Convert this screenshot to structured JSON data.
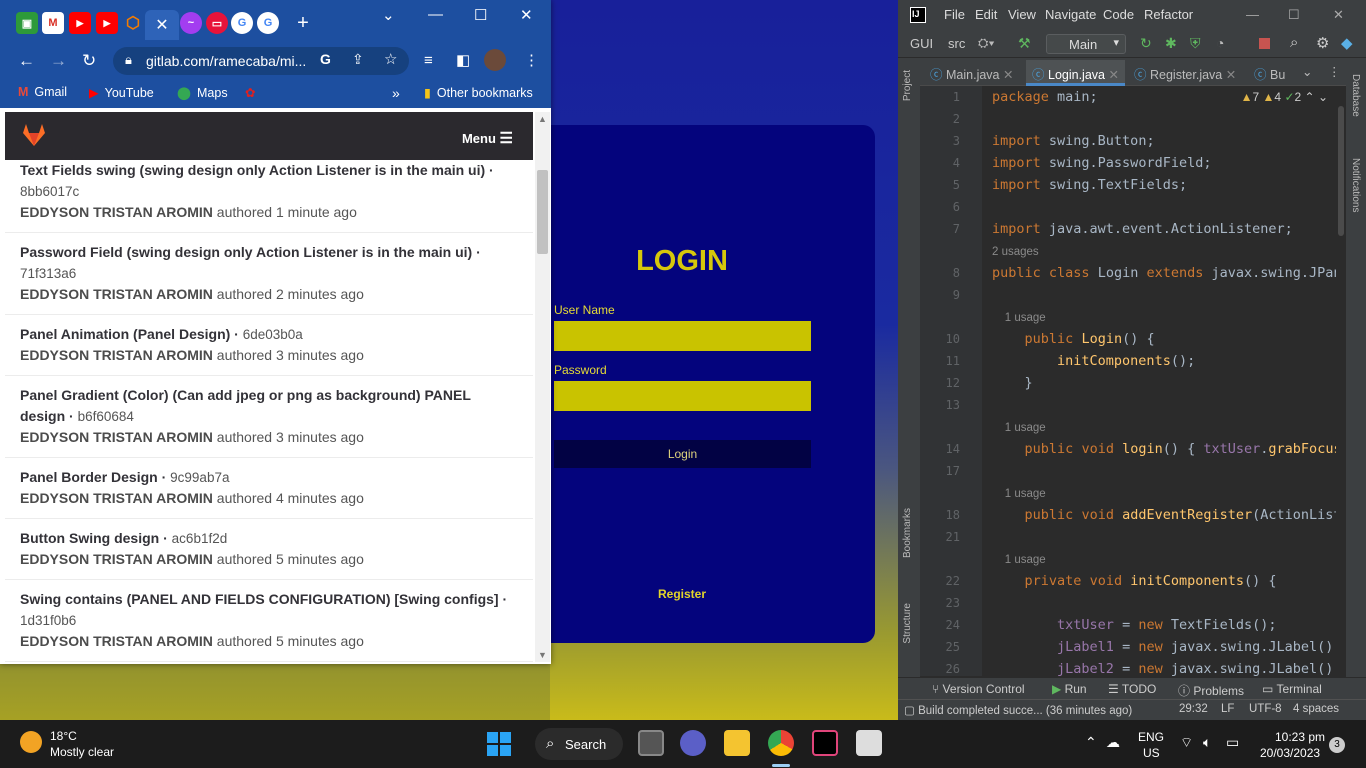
{
  "app_window": {
    "title": "LOGIN",
    "username_label": "User Name",
    "password_label": "Password",
    "login_button": "Login",
    "register_link": "Register"
  },
  "browser": {
    "url": "gitlab.com/ramecaba/mi...",
    "bookmarks": [
      "Gmail",
      "YouTube",
      "Maps"
    ],
    "other_bookmarks": "Other bookmarks",
    "gitlab_menu": "Menu",
    "commits": [
      {
        "title": "Text Fields swing (swing design only Action Listener is in the main ui)",
        "sha": "8bb6017c",
        "author": "EDDYSON TRISTAN AROMIN",
        "time": "authored 1 minute ago"
      },
      {
        "title": "Password Field (swing design only Action Listener is in the main ui)",
        "sha": "71f313a6",
        "author": "EDDYSON TRISTAN AROMIN",
        "time": "authored 2 minutes ago"
      },
      {
        "title": "Panel Animation (Panel Design)",
        "sha": "6de03b0a",
        "author": "EDDYSON TRISTAN AROMIN",
        "time": "authored 3 minutes ago"
      },
      {
        "title": "Panel Gradient (Color) (Can add jpeg or png as background) PANEL design",
        "sha": "b6f60684",
        "author": "EDDYSON TRISTAN AROMIN",
        "time": "authored 3 minutes ago"
      },
      {
        "title": "Panel Border Design",
        "sha": "9c99ab7a",
        "author": "EDDYSON TRISTAN AROMIN",
        "time": "authored 4 minutes ago"
      },
      {
        "title": "Button Swing design",
        "sha": "ac6b1f2d",
        "author": "EDDYSON TRISTAN AROMIN",
        "time": "authored 5 minutes ago"
      },
      {
        "title": "Swing contains (PANEL AND FIELDS CONFIGURATION) [Swing configs]",
        "sha": "1d31f0b6",
        "author": "EDDYSON TRISTAN AROMIN",
        "time": "authored 5 minutes ago"
      }
    ]
  },
  "ide": {
    "menu": [
      "File",
      "Edit",
      "View",
      "Navigate",
      "Code",
      "Refactor"
    ],
    "project": "GUI",
    "folder": "src",
    "run_config": "Main",
    "tabs": [
      "Main.java",
      "Login.java",
      "Register.java",
      "Bu"
    ],
    "inspections": {
      "warnings": "7",
      "weak": "4",
      "typos": "2"
    },
    "side_left": [
      "Project",
      "Bookmarks",
      "Structure"
    ],
    "side_right": [
      "Database",
      "Notifications"
    ],
    "lines": [
      {
        "n": "1",
        "code": "package main;"
      },
      {
        "n": "2",
        "code": ""
      },
      {
        "n": "3",
        "code": "import swing.Button;"
      },
      {
        "n": "4",
        "code": "import swing.PasswordField;"
      },
      {
        "n": "5",
        "code": "import swing.TextFields;"
      },
      {
        "n": "6",
        "code": ""
      },
      {
        "n": "7",
        "code": "import java.awt.event.ActionListener;"
      },
      {
        "n": "",
        "code": "2 usages"
      },
      {
        "n": "8",
        "code": "public class Login extends javax.swing.JPane"
      },
      {
        "n": "9",
        "code": ""
      },
      {
        "n": "",
        "code": "    1 usage"
      },
      {
        "n": "10",
        "code": "    public Login() {"
      },
      {
        "n": "11",
        "code": "        initComponents();"
      },
      {
        "n": "12",
        "code": "    }"
      },
      {
        "n": "13",
        "code": ""
      },
      {
        "n": "",
        "code": "    1 usage"
      },
      {
        "n": "14",
        "code": "    public void login() { txtUser.grabFocus("
      },
      {
        "n": "17",
        "code": ""
      },
      {
        "n": "",
        "code": "    1 usage"
      },
      {
        "n": "18",
        "code": "    public void addEventRegister(ActionListe"
      },
      {
        "n": "21",
        "code": ""
      },
      {
        "n": "",
        "code": "    1 usage"
      },
      {
        "n": "22",
        "code": "    private void initComponents() {"
      },
      {
        "n": "23",
        "code": ""
      },
      {
        "n": "24",
        "code": "        txtUser = new TextFields();"
      },
      {
        "n": "25",
        "code": "        jLabel1 = new javax.swing.JLabel();"
      },
      {
        "n": "26",
        "code": "        jLabel2 = new javax.swing.JLabel();"
      }
    ],
    "bottom_tools": [
      "Version Control",
      "Run",
      "TODO",
      "Problems",
      "Terminal"
    ],
    "status_msg": "Build completed succe... (36 minutes ago)",
    "position": "29:32",
    "line_sep": "LF",
    "encoding": "UTF-8",
    "indent": "4 spaces"
  },
  "taskbar": {
    "temp": "18°C",
    "weather": "Mostly clear",
    "search": "Search",
    "lang1": "ENG",
    "lang2": "US",
    "time": "10:23 pm",
    "date": "20/03/2023",
    "notif_count": "3"
  }
}
